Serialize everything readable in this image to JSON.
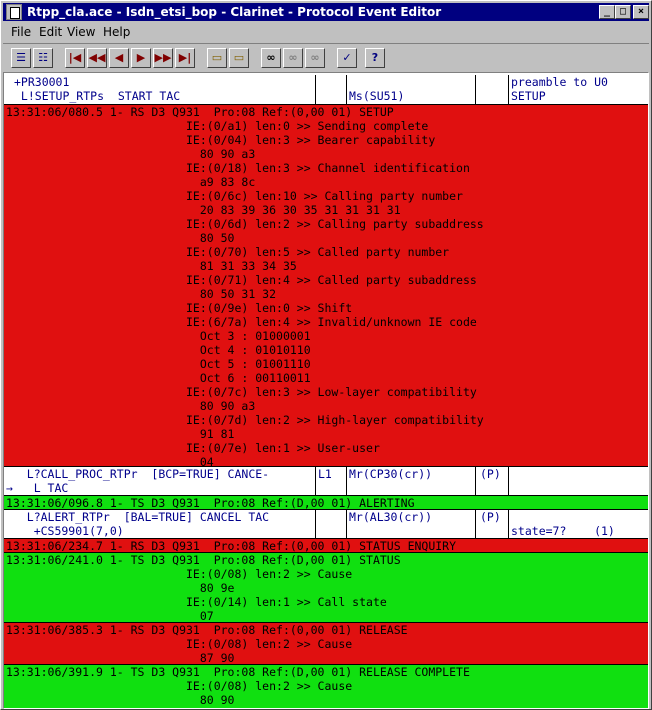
{
  "window": {
    "title": "Rtpp_cla.ace - Isdn_etsi_bop - Clarinet - Protocol Event Editor",
    "min": "_",
    "max": "□",
    "close": "×"
  },
  "menu": [
    "File",
    "Edit",
    "View",
    "Help"
  ],
  "toolbar": {
    "buttons": [
      {
        "name": "first-event-icon",
        "glyph": "|◀"
      },
      {
        "name": "prev-page-icon",
        "glyph": "◀◀"
      },
      {
        "name": "prev-event-icon",
        "glyph": "◀"
      },
      {
        "name": "next-event-icon",
        "glyph": "▶"
      },
      {
        "name": "next-page-icon",
        "glyph": "▶▶"
      },
      {
        "name": "last-event-icon",
        "glyph": "▶|"
      }
    ]
  },
  "colors": {
    "red": "#e01010",
    "green": "#10e010",
    "header_text": "#00008b",
    "titlebar": "#000080"
  },
  "header1": {
    "col1": "+PR30001\n L!SETUP_RTPs  START TAC",
    "col2": "",
    "col3": "\nMs(SU51)",
    "col4": "",
    "col5": "preamble to U0\nSETUP"
  },
  "events": {
    "e1": "13:31:06/080.5 1- RS D3 Q931  Pro:08 Ref:(0,00 01) SETUP\n                          IE:(0/a1) len:0 >> Sending complete\n                          IE:(0/04) len:3 >> Bearer capability\n                            80 90 a3\n                          IE:(0/18) len:3 >> Channel identification\n                            a9 83 8c\n                          IE:(0/6c) len:10 >> Calling party number\n                            20 83 39 36 30 35 31 31 31 31\n                          IE:(0/6d) len:2 >> Calling party subaddress\n                            80 50\n                          IE:(0/70) len:5 >> Called party number\n                            81 31 33 34 35\n                          IE:(0/71) len:4 >> Called party subaddress\n                            80 50 31 32\n                          IE:(0/9e) len:0 >> Shift\n                          IE:(6/7a) len:4 >> Invalid/unknown IE code\n                            Oct 3 : 01000001\n                            Oct 4 : 01010110\n                            Oct 5 : 01001110\n                            Oct 6 : 00110011\n                          IE:(0/7c) len:3 >> Low-layer compatibility\n                            80 90 a3\n                          IE:(0/7d) len:2 >> High-layer compatibility\n                            91 81\n                          IE:(0/7e) len:1 >> User-user\n                            04",
    "e2": "13:31:06/096.8 1- TS D3 Q931  Pro:08 Ref:(D,00 01) ALERTING",
    "e3": "13:31:06/234.7 1- RS D3 Q931  Pro:08 Ref:(0,00 01) STATUS ENQUIRY",
    "e4": "13:31:06/241.0 1- TS D3 Q931  Pro:08 Ref:(D,00 01) STATUS\n                          IE:(0/08) len:2 >> Cause\n                            80 9e\n                          IE:(0/14) len:1 >> Call state\n                            07",
    "e5": "13:31:06/385.3 1- RS D3 Q931  Pro:08 Ref:(0,00 01) RELEASE\n                          IE:(0/08) len:2 >> Cause\n                            87 90",
    "e6": "13:31:06/391.9 1- TS D3 Q931  Pro:08 Ref:(D,00 01) RELEASE COMPLETE\n                          IE:(0/08) len:2 >> Cause\n                            80 90"
  },
  "header2": {
    "col1": "   L?CALL_PROC_RTPr  [BCP=TRUE] CANCE-\n→   L TAC",
    "col2": "L1",
    "col3": "Mr(CP30(cr))",
    "col4": "(P)",
    "col5": ""
  },
  "header3": {
    "col1": "   L?ALERT_RTPr  [BAL=TRUE] CANCEL TAC\n    +CS59901(7,0)",
    "col2": "",
    "col3": "Mr(AL30(cr))",
    "col4": "(P)",
    "col5": "\nstate=7?    (1)"
  }
}
